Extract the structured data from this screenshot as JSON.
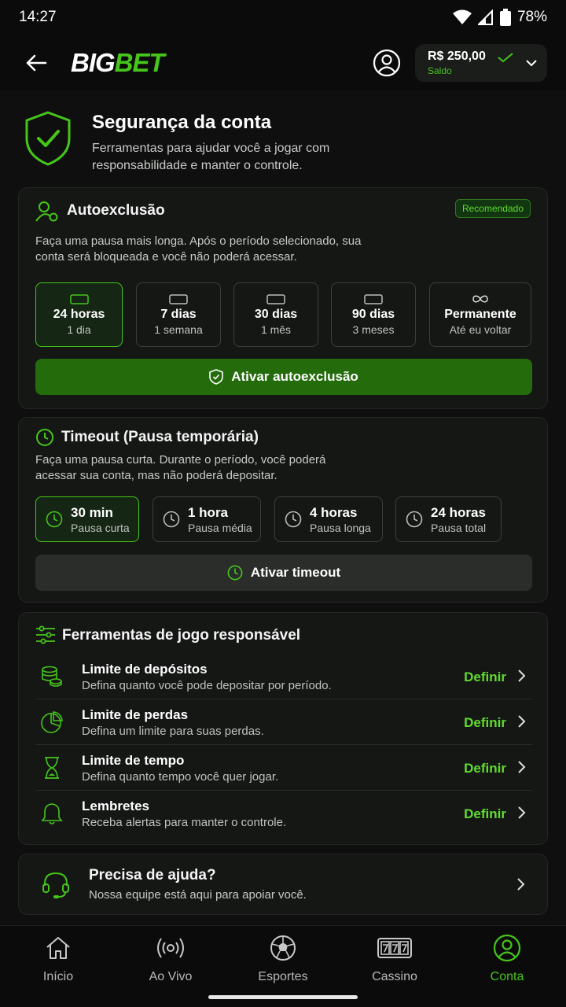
{
  "status": {
    "time": "14:27",
    "battery": "78%"
  },
  "header": {
    "logo_big": "BIG",
    "logo_bet": "BET",
    "balance": "R$ 250,00",
    "balance_label": "Saldo"
  },
  "section": {
    "title": "Segurança da conta",
    "description": "Ferramentas para ajudar você a jogar com responsabilidade e manter o controle."
  },
  "self_exclusion": {
    "title": "Autoexclusão",
    "badge": "Recomendado",
    "description": "Faça uma pausa mais longa. Após o período selecionado, sua conta será bloqueada e você não poderá acessar.",
    "options": [
      {
        "label": "24 horas",
        "sub": "1 dia",
        "active": true
      },
      {
        "label": "7 dias",
        "sub": "1 semana"
      },
      {
        "label": "30 dias",
        "sub": "1 mês"
      },
      {
        "label": "90 dias",
        "sub": "3 meses"
      },
      {
        "label": "Permanente",
        "sub": "Até eu voltar"
      }
    ],
    "button": "Ativar autoexclusão"
  },
  "timeout": {
    "title": "Timeout (Pausa temporária)",
    "description": "Faça uma pausa curta. Durante o período, você poderá acessar sua conta, mas não poderá depositar.",
    "options": [
      {
        "label": "30 min",
        "sub": "Pausa curta",
        "active": true
      },
      {
        "label": "1 hora",
        "sub": "Pausa média"
      },
      {
        "label": "4 horas",
        "sub": "Pausa longa"
      },
      {
        "label": "24 horas",
        "sub": "Pausa total"
      }
    ],
    "button": "Ativar timeout"
  },
  "tools": {
    "title": "Ferramentas de jogo responsável",
    "action": "Definir",
    "items": [
      {
        "name": "Limite de depósitos",
        "desc": "Defina quanto você pode depositar por período.",
        "icon": "coins-icon"
      },
      {
        "name": "Limite de perdas",
        "desc": "Defina um limite para suas perdas.",
        "icon": "pie-chart-icon"
      },
      {
        "name": "Limite de tempo",
        "desc": "Defina quanto tempo você quer jogar.",
        "icon": "hourglass-icon"
      },
      {
        "name": "Lembretes",
        "desc": "Receba alertas para manter o controle.",
        "icon": "bell-icon"
      }
    ]
  },
  "help": {
    "title": "Precisa de ajuda?",
    "desc": "Nossa equipe está aqui para apoiar você."
  },
  "nav": {
    "items": [
      {
        "label": "Início",
        "icon": "home-icon"
      },
      {
        "label": "Ao Vivo",
        "icon": "live-icon"
      },
      {
        "label": "Esportes",
        "icon": "soccer-ball-icon"
      },
      {
        "label": "Cassino",
        "icon": "slot-machine-icon"
      },
      {
        "label": "Conta",
        "icon": "user-icon",
        "active": true
      }
    ]
  },
  "colors": {
    "accent": "#46c51b",
    "button_green": "#246b0c",
    "background": "#0e0f0e",
    "card": "#151715"
  }
}
